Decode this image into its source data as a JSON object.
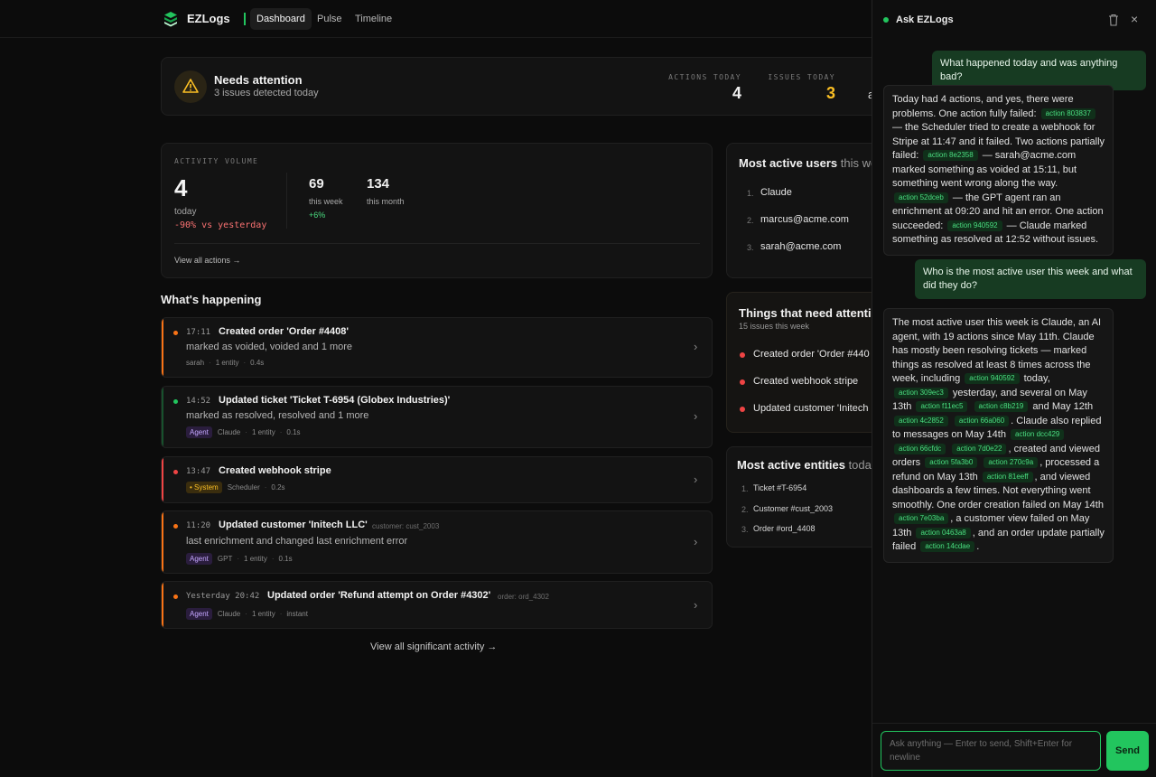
{
  "app": {
    "name": "EZLogs"
  },
  "nav": {
    "tabs": [
      "Dashboard",
      "Pulse",
      "Timeline"
    ]
  },
  "attention": {
    "title": "Needs attention",
    "subtitle": "3 issues detected today",
    "stats": [
      {
        "label": "ACTIONS TODAY",
        "value": "4"
      },
      {
        "label": "ISSUES TODAY",
        "value": "3"
      }
    ],
    "overflow_text": "a"
  },
  "activity": {
    "label": "ACTIVITY VOLUME",
    "today_value": "4",
    "today_label": "today",
    "today_delta": "-90% vs yesterday",
    "week_value": "69",
    "week_label": "this week",
    "week_delta": "+6%",
    "month_value": "134",
    "month_label": "this month",
    "link": "View all actions →"
  },
  "happening": {
    "title": "What's happening",
    "items": [
      {
        "time": "17:11",
        "title": "Created order 'Order #4408'",
        "ref": "",
        "desc": "marked as voided, voided and 1 more",
        "badge": "",
        "actor": "sarah",
        "entities": "1 entity",
        "duration": "0.4s",
        "color": "#f97316"
      },
      {
        "time": "14:52",
        "title": "Updated ticket 'Ticket T-6954 (Globex Industries)'",
        "ref": "",
        "desc": "marked as resolved, resolved and 1 more",
        "badge": "Agent",
        "actor": "Claude",
        "entities": "1 entity",
        "duration": "0.1s",
        "color": "#22c55e"
      },
      {
        "time": "13:47",
        "title": "Created webhook stripe",
        "ref": "",
        "desc": "",
        "badge": "System",
        "actor": "Scheduler",
        "entities": "",
        "duration": "0.2s",
        "color": "#ef4444"
      },
      {
        "time": "11:20",
        "title": "Updated customer 'Initech LLC'",
        "ref": "customer: cust_2003",
        "desc": "last enrichment and changed last enrichment error",
        "badge": "Agent",
        "actor": "GPT",
        "entities": "1 entity",
        "duration": "0.1s",
        "color": "#f97316"
      },
      {
        "time": "Yesterday 20:42",
        "title": "Updated order 'Refund attempt on Order #4302'",
        "ref": "order: ord_4302",
        "desc": "",
        "badge": "Agent",
        "actor": "Claude",
        "entities": "1 entity",
        "duration": "instant",
        "color": "#f97316"
      }
    ],
    "view_all": "View all significant activity →"
  },
  "active_users": {
    "title": "Most active users",
    "title_suffix": "this we",
    "items": [
      "Claude",
      "marcus@acme.com",
      "sarah@acme.com"
    ]
  },
  "need_attention": {
    "title": "Things that need attentio",
    "subtitle": "15 issues this week",
    "items": [
      "Created order 'Order #440",
      "Created webhook stripe",
      "Updated customer 'Initech"
    ]
  },
  "active_entities": {
    "title": "Most active entities",
    "title_suffix": "toda",
    "items": [
      "Ticket #T-6954",
      "Customer #cust_2003",
      "Order #ord_4408"
    ]
  },
  "chat": {
    "title": "Ask EZLogs",
    "q1": "What happened today and was anything bad?",
    "a1": [
      {
        "t": "Today had 4 actions, and yes, there were problems. One action fully failed: "
      },
      {
        "c": "action 803837"
      },
      {
        "t": " — the Scheduler tried to create a webhook for Stripe at 11:47 and it failed. Two actions partially failed: "
      },
      {
        "c": "action 8e2358"
      },
      {
        "t": " — sarah@acme.com marked something as voided at 15:11, but something went wrong along the way. "
      },
      {
        "c": "action 52dceb"
      },
      {
        "t": " — the GPT agent ran an enrichment at 09:20 and hit an error. One action succeeded: "
      },
      {
        "c": "action 940592"
      },
      {
        "t": " — Claude marked something as resolved at 12:52 without issues."
      }
    ],
    "q2": "Who is the most active user this week and what did they do?",
    "a2": [
      {
        "t": "The most active user this week is Claude, an AI agent, with 19 actions since May 11th. Claude has mostly been resolving tickets — marked things as resolved at least 8 times across the week, including "
      },
      {
        "c": "action 940592"
      },
      {
        "t": " today, "
      },
      {
        "c": "action 309ec3"
      },
      {
        "t": " yesterday, and several on May 13th "
      },
      {
        "c": "action f11ec5"
      },
      {
        "t": " "
      },
      {
        "c": "action c8b219"
      },
      {
        "t": " and May 12th "
      },
      {
        "c": "action 4c2852"
      },
      {
        "t": " "
      },
      {
        "c": "action 66a060"
      },
      {
        "t": ". Claude also replied to messages on May 14th "
      },
      {
        "c": "action dcc429"
      },
      {
        "t": " "
      },
      {
        "c": "action 66cfdc"
      },
      {
        "t": " "
      },
      {
        "c": "action 7d0e22"
      },
      {
        "t": ", created and viewed orders "
      },
      {
        "c": "action 5fa3b0"
      },
      {
        "t": " "
      },
      {
        "c": "action 270c9a"
      },
      {
        "t": ", processed a refund on May 13th "
      },
      {
        "c": "action 81eeff"
      },
      {
        "t": ", and viewed dashboards a few times. Not everything went smoothly. One order creation failed on May 14th "
      },
      {
        "c": "action 7e03ba"
      },
      {
        "t": ", a customer view failed on May 13th "
      },
      {
        "c": "action 0463a8"
      },
      {
        "t": ", and an order update partially failed "
      },
      {
        "c": "action 14cdae"
      },
      {
        "t": "."
      }
    ],
    "input_placeholder": "Ask anything — Enter to send, Shift+Enter for newline",
    "send_label": "Send"
  },
  "colors": {
    "accent": "#22c55e",
    "warning": "#fbbf24",
    "danger": "#ef4444",
    "orange": "#f97316",
    "agent": "#c4a6ff"
  }
}
